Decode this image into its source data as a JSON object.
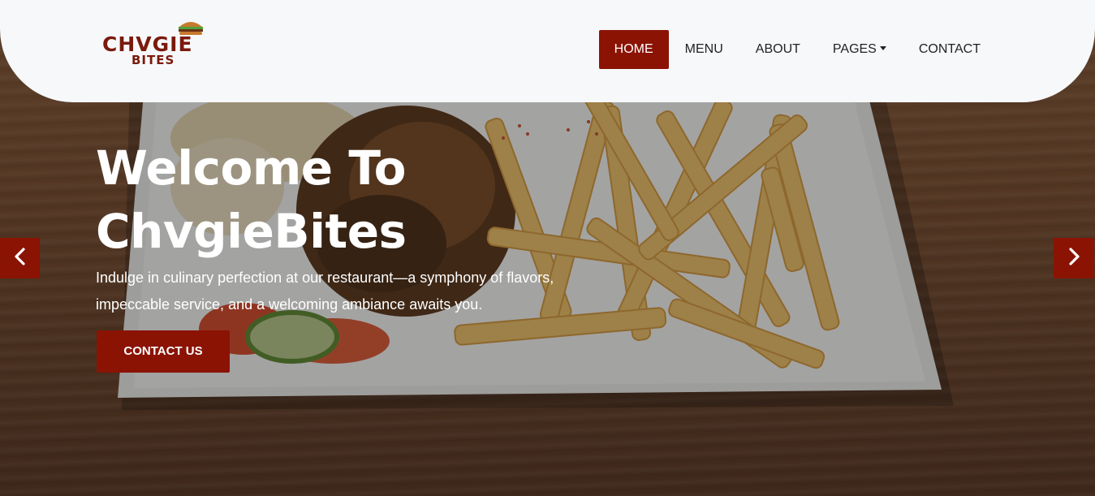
{
  "brand": {
    "name_line1": "CHVGIE",
    "name_line2": "BITES",
    "logo_icon": "burger-icon",
    "color": "#7a1a0c"
  },
  "nav": {
    "items": [
      {
        "label": "HOME",
        "active": true
      },
      {
        "label": "MENU",
        "active": false
      },
      {
        "label": "ABOUT",
        "active": false
      },
      {
        "label": "PAGES",
        "active": false,
        "dropdown": true
      },
      {
        "label": "CONTACT",
        "active": false
      }
    ]
  },
  "hero": {
    "title_line1": "Welcome To",
    "title_line2": "ChvgieBites",
    "subtitle_line1": "Indulge in culinary perfection at our restaurant—a symphony of flavors,",
    "subtitle_line2": "impeccable service, and a welcoming ambiance awaits you.",
    "cta_label": "CONTACT US",
    "prev_icon": "chevron-left-icon",
    "next_icon": "chevron-right-icon"
  },
  "colors": {
    "accent": "#8b1304",
    "navbar_bg": "#f7f8fa",
    "text_light": "#ffffff"
  }
}
